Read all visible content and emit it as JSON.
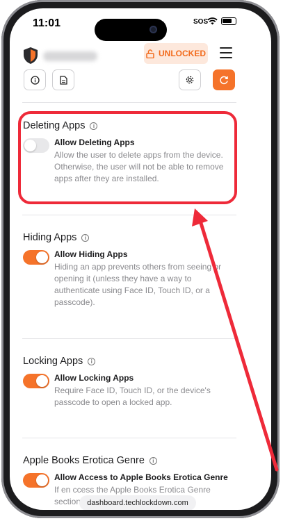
{
  "status": {
    "time": "11:01",
    "sos": "SOS",
    "icons": [
      "signal-icon",
      "wifi-icon",
      "battery-icon"
    ]
  },
  "header": {
    "badge_label": "UNLOCKED",
    "badge_icon": "unlock-icon",
    "menu_icon": "menu-icon",
    "accent_color": "#f5732a"
  },
  "toolbar": {
    "buttons": [
      "info-icon",
      "document-icon",
      "gear-icon",
      "refresh-icon"
    ]
  },
  "sections": [
    {
      "title": "Deleting Apps",
      "setting_label": "Allow Deleting Apps",
      "enabled": false,
      "description": "Allow the user to delete apps from the device. Otherwise, the user will not be able to remove apps after they are installed."
    },
    {
      "title": "Hiding Apps",
      "setting_label": "Allow Hiding Apps",
      "enabled": true,
      "description": "Hiding an app prevents others from seeing or opening it (unless they have a way to authenticate using Face ID, Touch ID, or a passcode)."
    },
    {
      "title": "Locking Apps",
      "setting_label": "Allow Locking Apps",
      "enabled": true,
      "description": "Require Face ID, Touch ID, or the device's passcode to open a locked app."
    },
    {
      "title": "Apple Books Erotica Genre",
      "setting_label": "Allow Access to Apple Books Erotica Genre",
      "enabled": true,
      "description": "If en                                    ccess the Apple Books Erotica Genre section"
    }
  ],
  "browser": {
    "url": "dashboard.techlockdown.com"
  },
  "annotation": {
    "highlight_color": "#ee2a39"
  }
}
